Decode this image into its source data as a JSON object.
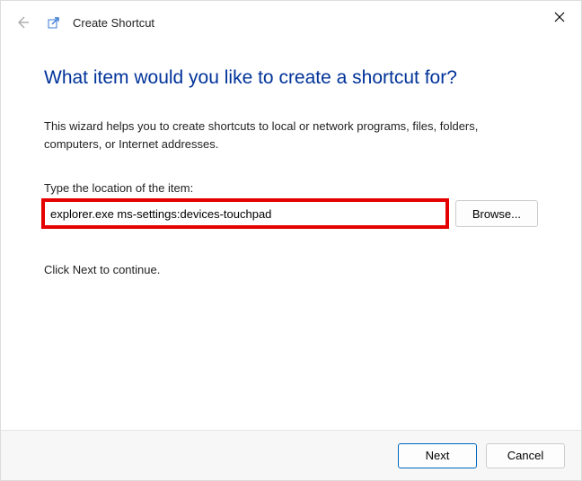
{
  "header": {
    "title": "Create Shortcut"
  },
  "main": {
    "heading": "What item would you like to create a shortcut for?",
    "description": "This wizard helps you to create shortcuts to local or network programs, files, folders, computers, or Internet addresses.",
    "location_label": "Type the location of the item:",
    "location_value": "explorer.exe ms-settings:devices-touchpad",
    "browse_label": "Browse...",
    "continue_text": "Click Next to continue."
  },
  "footer": {
    "next_label": "Next",
    "cancel_label": "Cancel"
  }
}
